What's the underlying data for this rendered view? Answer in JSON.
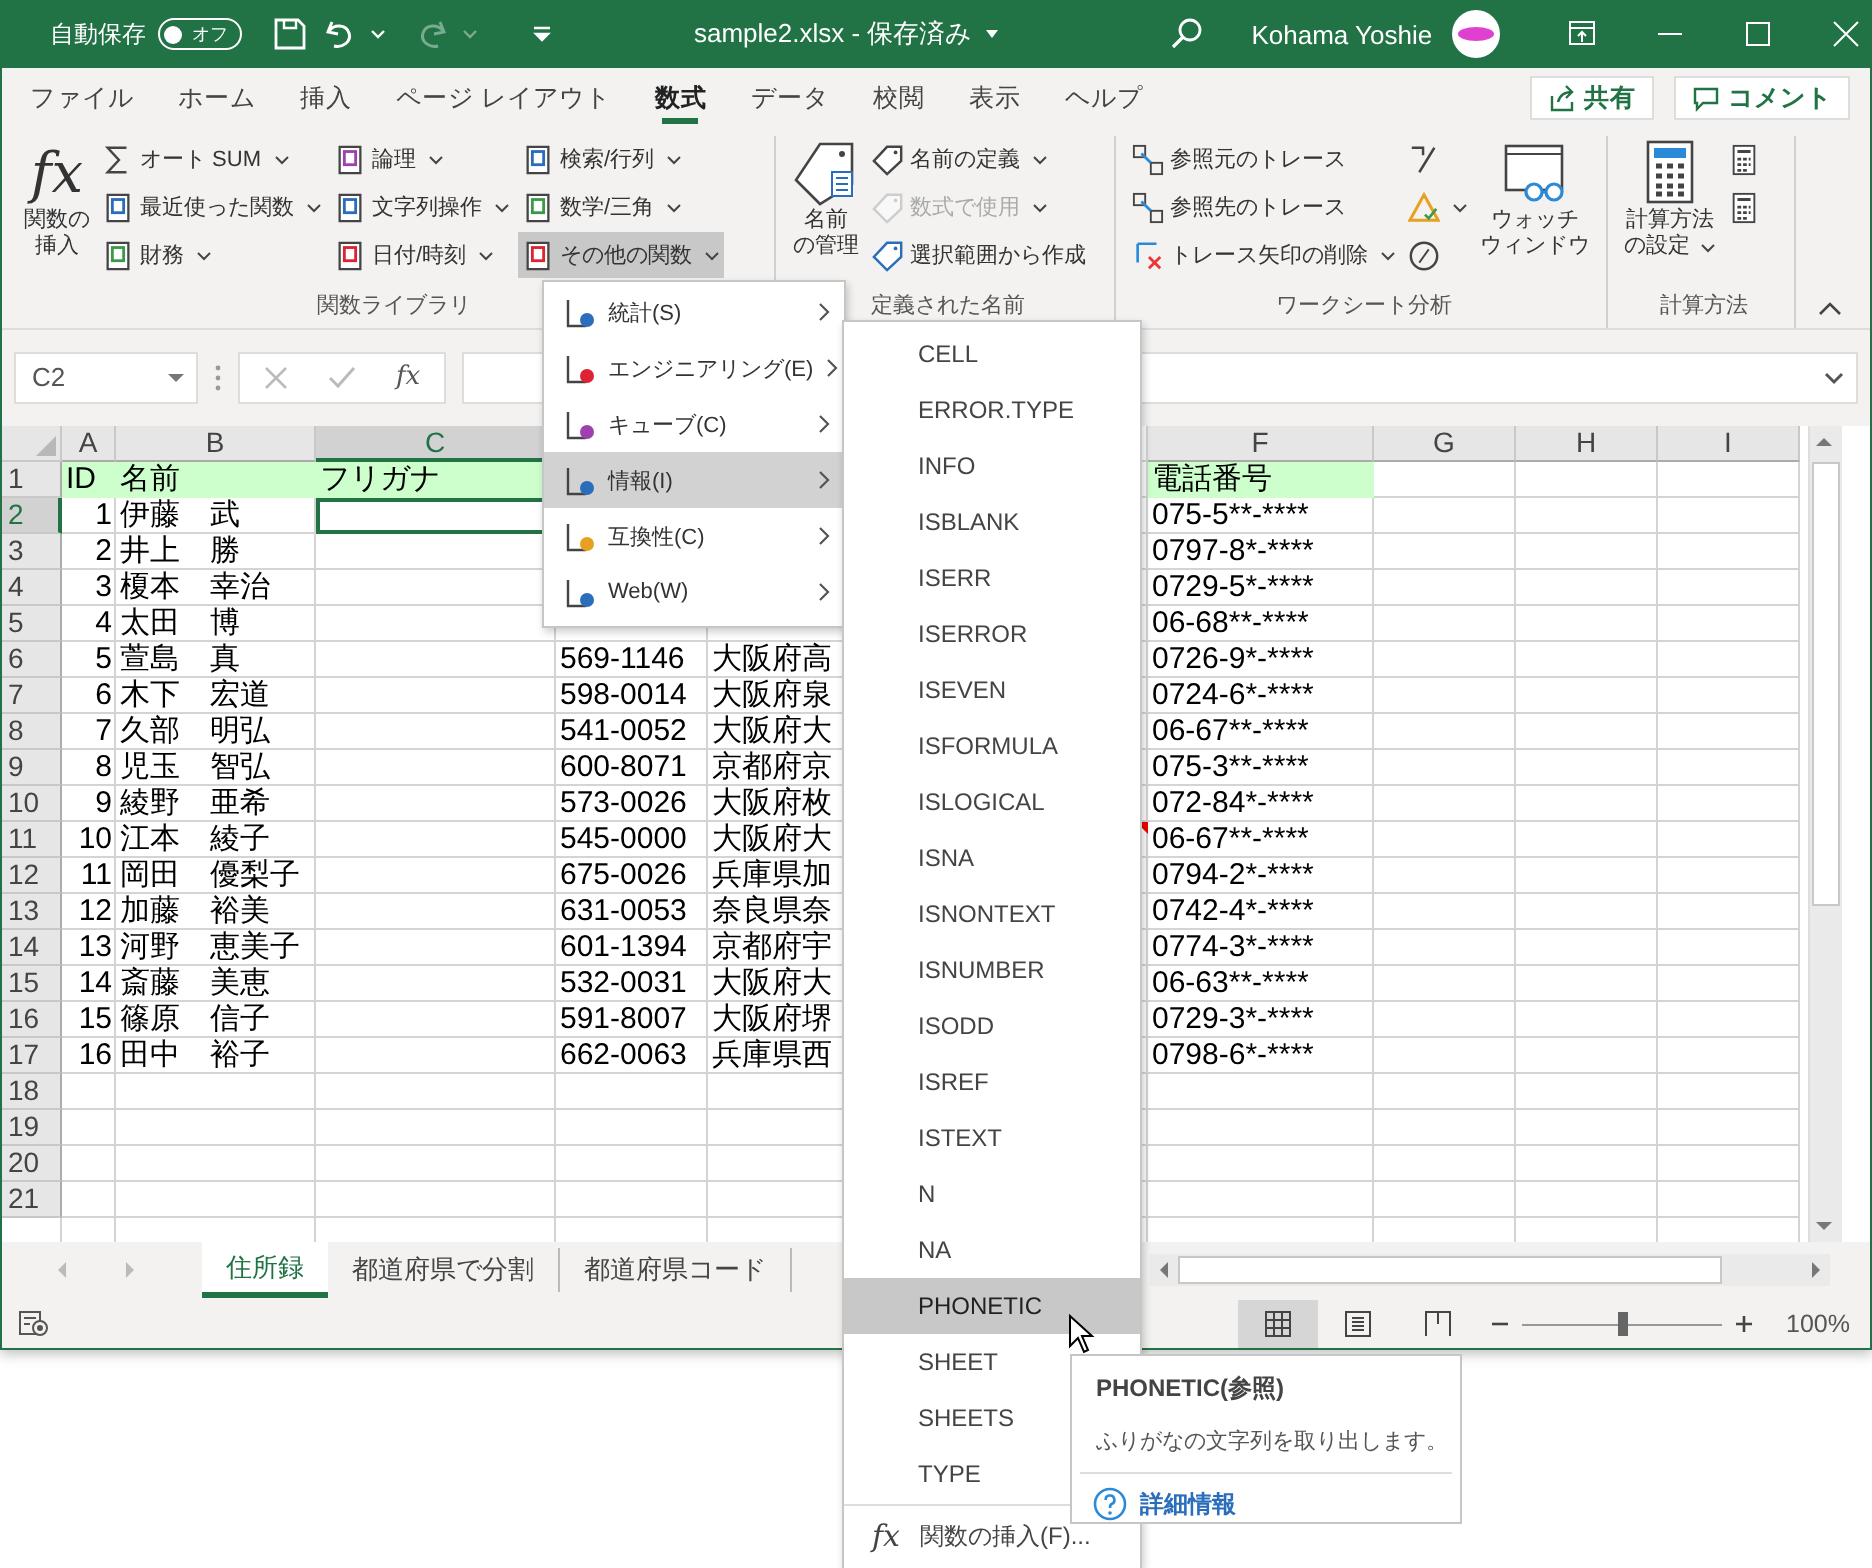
{
  "title_bar": {
    "autosave": {
      "label": "自動保存",
      "state_label": "オフ",
      "on": false
    },
    "redo": {
      "disabled": true
    },
    "document_title": "sample2.xlsx - 保存済み",
    "user_name": "Kohama Yoshie"
  },
  "ribbon_tabs": [
    {
      "label": "ファイル",
      "selected": false
    },
    {
      "label": "ホーム",
      "selected": false
    },
    {
      "label": "挿入",
      "selected": false
    },
    {
      "label": "ページ レイアウト",
      "selected": false
    },
    {
      "label": "数式",
      "selected": true
    },
    {
      "label": "データ",
      "selected": false
    },
    {
      "label": "校閲",
      "selected": false
    },
    {
      "label": "表示",
      "selected": false
    },
    {
      "label": "ヘルプ",
      "selected": false
    }
  ],
  "share_button": "共有",
  "comment_button": "コメント",
  "ribbon_groups": [
    {
      "label": "関数ライブラリ",
      "items": [
        {
          "kind": "large",
          "glyph": "fx",
          "lines": [
            "関数の",
            "挿入"
          ],
          "dropdown": false
        },
        {
          "kind": "column",
          "buttons": [
            {
              "label": "オート SUM",
              "dropdown": true,
              "disabled": false,
              "pressed": false
            },
            {
              "label": "最近使った関数",
              "dropdown": true,
              "disabled": false,
              "pressed": false
            },
            {
              "label": "財務",
              "dropdown": true,
              "disabled": false,
              "pressed": false
            }
          ]
        },
        {
          "kind": "column",
          "buttons": [
            {
              "label": "論理",
              "dropdown": true,
              "disabled": false,
              "pressed": false
            },
            {
              "label": "文字列操作",
              "dropdown": true,
              "disabled": false,
              "pressed": false
            },
            {
              "label": "日付/時刻",
              "dropdown": true,
              "disabled": false,
              "pressed": false
            }
          ]
        },
        {
          "kind": "column",
          "buttons": [
            {
              "label": "検索/行列",
              "dropdown": true,
              "disabled": false,
              "pressed": false
            },
            {
              "label": "数学/三角",
              "dropdown": true,
              "disabled": false,
              "pressed": false
            },
            {
              "label": "その他の関数",
              "dropdown": true,
              "disabled": false,
              "pressed": true
            }
          ]
        }
      ]
    },
    {
      "label": "定義された名前",
      "items": [
        {
          "kind": "large",
          "lines": [
            "名前",
            "の管理"
          ],
          "dropdown": false
        },
        {
          "kind": "column",
          "buttons": [
            {
              "label": "名前の定義",
              "dropdown": true,
              "disabled": false,
              "pressed": false
            },
            {
              "label": "数式で使用",
              "dropdown": true,
              "disabled": true,
              "pressed": false
            },
            {
              "label": "選択範囲から作成",
              "dropdown": false,
              "disabled": false,
              "pressed": false
            }
          ]
        }
      ]
    },
    {
      "label": "ワークシート分析",
      "items": [
        {
          "kind": "column",
          "buttons": [
            {
              "label": "参照元のトレース",
              "dropdown": false,
              "disabled": false,
              "pressed": false
            },
            {
              "label": "参照先のトレース",
              "dropdown": false,
              "disabled": false,
              "pressed": false
            },
            {
              "label": "トレース矢印の削除",
              "dropdown": true,
              "disabled": false,
              "pressed": false
            }
          ]
        },
        {
          "kind": "column",
          "buttons": [
            {
              "dropdown": false,
              "disabled": false,
              "pressed": false
            },
            {
              "dropdown": true,
              "disabled": false,
              "pressed": false
            },
            {
              "dropdown": false,
              "disabled": false,
              "pressed": false
            }
          ]
        },
        {
          "kind": "large",
          "lines": [
            "ウォッチ",
            "ウィンドウ"
          ],
          "dropdown": false
        }
      ]
    },
    {
      "label": "計算方法",
      "items": [
        {
          "kind": "large",
          "lines": [
            "計算方法",
            "の設定"
          ],
          "dropdown": true
        },
        {
          "kind": "column",
          "buttons": [
            {
              "dropdown": false,
              "disabled": false,
              "pressed": false
            },
            {
              "dropdown": false,
              "disabled": false,
              "pressed": false
            }
          ]
        }
      ]
    }
  ],
  "formula_bar": {
    "name_box": "C2",
    "insert_function_glyph": "fx"
  },
  "columns": [
    {
      "label": "A",
      "selected": false
    },
    {
      "label": "B",
      "selected": false
    },
    {
      "label": "C",
      "selected": true
    },
    {
      "label": "F",
      "selected": false
    },
    {
      "label": "G",
      "selected": false
    },
    {
      "label": "H",
      "selected": false
    },
    {
      "label": "I",
      "selected": false
    }
  ],
  "rows": [
    {
      "number": "1",
      "kind": "header",
      "selected": false,
      "id": "ID",
      "name": "名前",
      "furigana": "フリガナ",
      "phone": "電話番号"
    },
    {
      "number": "2",
      "kind": "data",
      "selected": true,
      "id": "1",
      "name": "伊藤　武",
      "phone": "075-5**-****"
    },
    {
      "number": "3",
      "kind": "data",
      "selected": false,
      "id": "2",
      "name": "井上　勝",
      "phone": "0797-8*-****"
    },
    {
      "number": "4",
      "kind": "data",
      "selected": false,
      "id": "3",
      "name": "榎本　幸治",
      "phone": "0729-5*-****"
    },
    {
      "number": "5",
      "kind": "data",
      "selected": false,
      "id": "4",
      "name": "太田　博",
      "phone": "06-68**-****"
    },
    {
      "number": "6",
      "kind": "data",
      "selected": false,
      "id": "5",
      "name": "萱島　真",
      "zip": "569-1146",
      "address": "大阪府高",
      "phone": "0726-9*-****"
    },
    {
      "number": "7",
      "kind": "data",
      "selected": false,
      "id": "6",
      "name": "木下　宏道",
      "zip": "598-0014",
      "address": "大阪府泉",
      "phone": "0724-6*-****"
    },
    {
      "number": "8",
      "kind": "data",
      "selected": false,
      "id": "7",
      "name": "久部　明弘",
      "zip": "541-0052",
      "address": "大阪府大",
      "phone": "06-67**-****"
    },
    {
      "number": "9",
      "kind": "data",
      "selected": false,
      "id": "8",
      "name": "児玉　智弘",
      "zip": "600-8071",
      "address": "京都府京",
      "phone": "075-3**-****"
    },
    {
      "number": "10",
      "kind": "data",
      "selected": false,
      "id": "9",
      "name": "綾野　亜希",
      "zip": "573-0026",
      "address": "大阪府枚",
      "phone": "072-84*-****"
    },
    {
      "number": "11",
      "kind": "data",
      "selected": false,
      "comment": true,
      "id": "10",
      "name": "江本　綾子",
      "zip": "545-0000",
      "address": "大阪府大",
      "phone": "06-67**-****"
    },
    {
      "number": "12",
      "kind": "data",
      "selected": false,
      "id": "11",
      "name": "岡田　優梨子",
      "zip": "675-0026",
      "address": "兵庫県加",
      "phone": "0794-2*-****"
    },
    {
      "number": "13",
      "kind": "data",
      "selected": false,
      "id": "12",
      "name": "加藤　裕美",
      "zip": "631-0053",
      "address": "奈良県奈",
      "phone": "0742-4*-****"
    },
    {
      "number": "14",
      "kind": "data",
      "selected": false,
      "id": "13",
      "name": "河野　恵美子",
      "zip": "601-1394",
      "address": "京都府宇",
      "phone": "0774-3*-****"
    },
    {
      "number": "15",
      "kind": "data",
      "selected": false,
      "id": "14",
      "name": "斎藤　美恵",
      "zip": "532-0031",
      "address": "大阪府大",
      "phone": "06-63**-****"
    },
    {
      "number": "16",
      "kind": "data",
      "selected": false,
      "id": "15",
      "name": "篠原　信子",
      "zip": "591-8007",
      "address": "大阪府堺",
      "phone": "0729-3*-****"
    },
    {
      "number": "17",
      "kind": "data",
      "selected": false,
      "id": "16",
      "name": "田中　裕子",
      "zip": "662-0063",
      "address": "兵庫県西",
      "phone": "0798-6*-****"
    },
    {
      "number": "18",
      "kind": "data",
      "selected": false
    },
    {
      "number": "19",
      "kind": "data",
      "selected": false
    },
    {
      "number": "20",
      "kind": "data",
      "selected": false
    },
    {
      "number": "21",
      "kind": "data",
      "selected": false
    }
  ],
  "sheet_tabs": [
    {
      "label": "住所録",
      "selected": true
    },
    {
      "label": "都道府県で分割",
      "selected": false
    },
    {
      "label": "都道府県コード",
      "selected": false
    }
  ],
  "status_bar": {
    "views": [
      {
        "selected": true
      },
      {
        "selected": false
      },
      {
        "selected": false
      }
    ],
    "zoom": {
      "label": "100%",
      "level": 0.5
    }
  },
  "more_functions_menu": [
    {
      "label": "統計(S)",
      "selected": false
    },
    {
      "label": "エンジニアリング(E)",
      "selected": false
    },
    {
      "label": "キューブ(C)",
      "selected": false
    },
    {
      "label": "情報(I)",
      "selected": true
    },
    {
      "label": "互換性(C)",
      "selected": false
    },
    {
      "label": "Web(W)",
      "selected": false
    }
  ],
  "info_menu": {
    "items": [
      {
        "label": "CELL",
        "selected": false
      },
      {
        "label": "ERROR.TYPE",
        "selected": false
      },
      {
        "label": "INFO",
        "selected": false
      },
      {
        "label": "ISBLANK",
        "selected": false
      },
      {
        "label": "ISERR",
        "selected": false
      },
      {
        "label": "ISERROR",
        "selected": false
      },
      {
        "label": "ISEVEN",
        "selected": false
      },
      {
        "label": "ISFORMULA",
        "selected": false
      },
      {
        "label": "ISLOGICAL",
        "selected": false
      },
      {
        "label": "ISNA",
        "selected": false
      },
      {
        "label": "ISNONTEXT",
        "selected": false
      },
      {
        "label": "ISNUMBER",
        "selected": false
      },
      {
        "label": "ISODD",
        "selected": false
      },
      {
        "label": "ISREF",
        "selected": false
      },
      {
        "label": "ISTEXT",
        "selected": false
      },
      {
        "label": "N",
        "selected": false
      },
      {
        "label": "NA",
        "selected": false
      },
      {
        "label": "PHONETIC",
        "selected": true
      },
      {
        "label": "SHEET",
        "selected": false
      },
      {
        "label": "SHEETS",
        "selected": false
      },
      {
        "label": "TYPE",
        "selected": false
      }
    ],
    "footer": {
      "glyph": "fx",
      "label": "関数の挿入(F)..."
    }
  },
  "tooltip": {
    "title": "PHONETIC(参照)",
    "description": "ふりがなの文字列を取り出します。",
    "link": "詳細情報"
  }
}
